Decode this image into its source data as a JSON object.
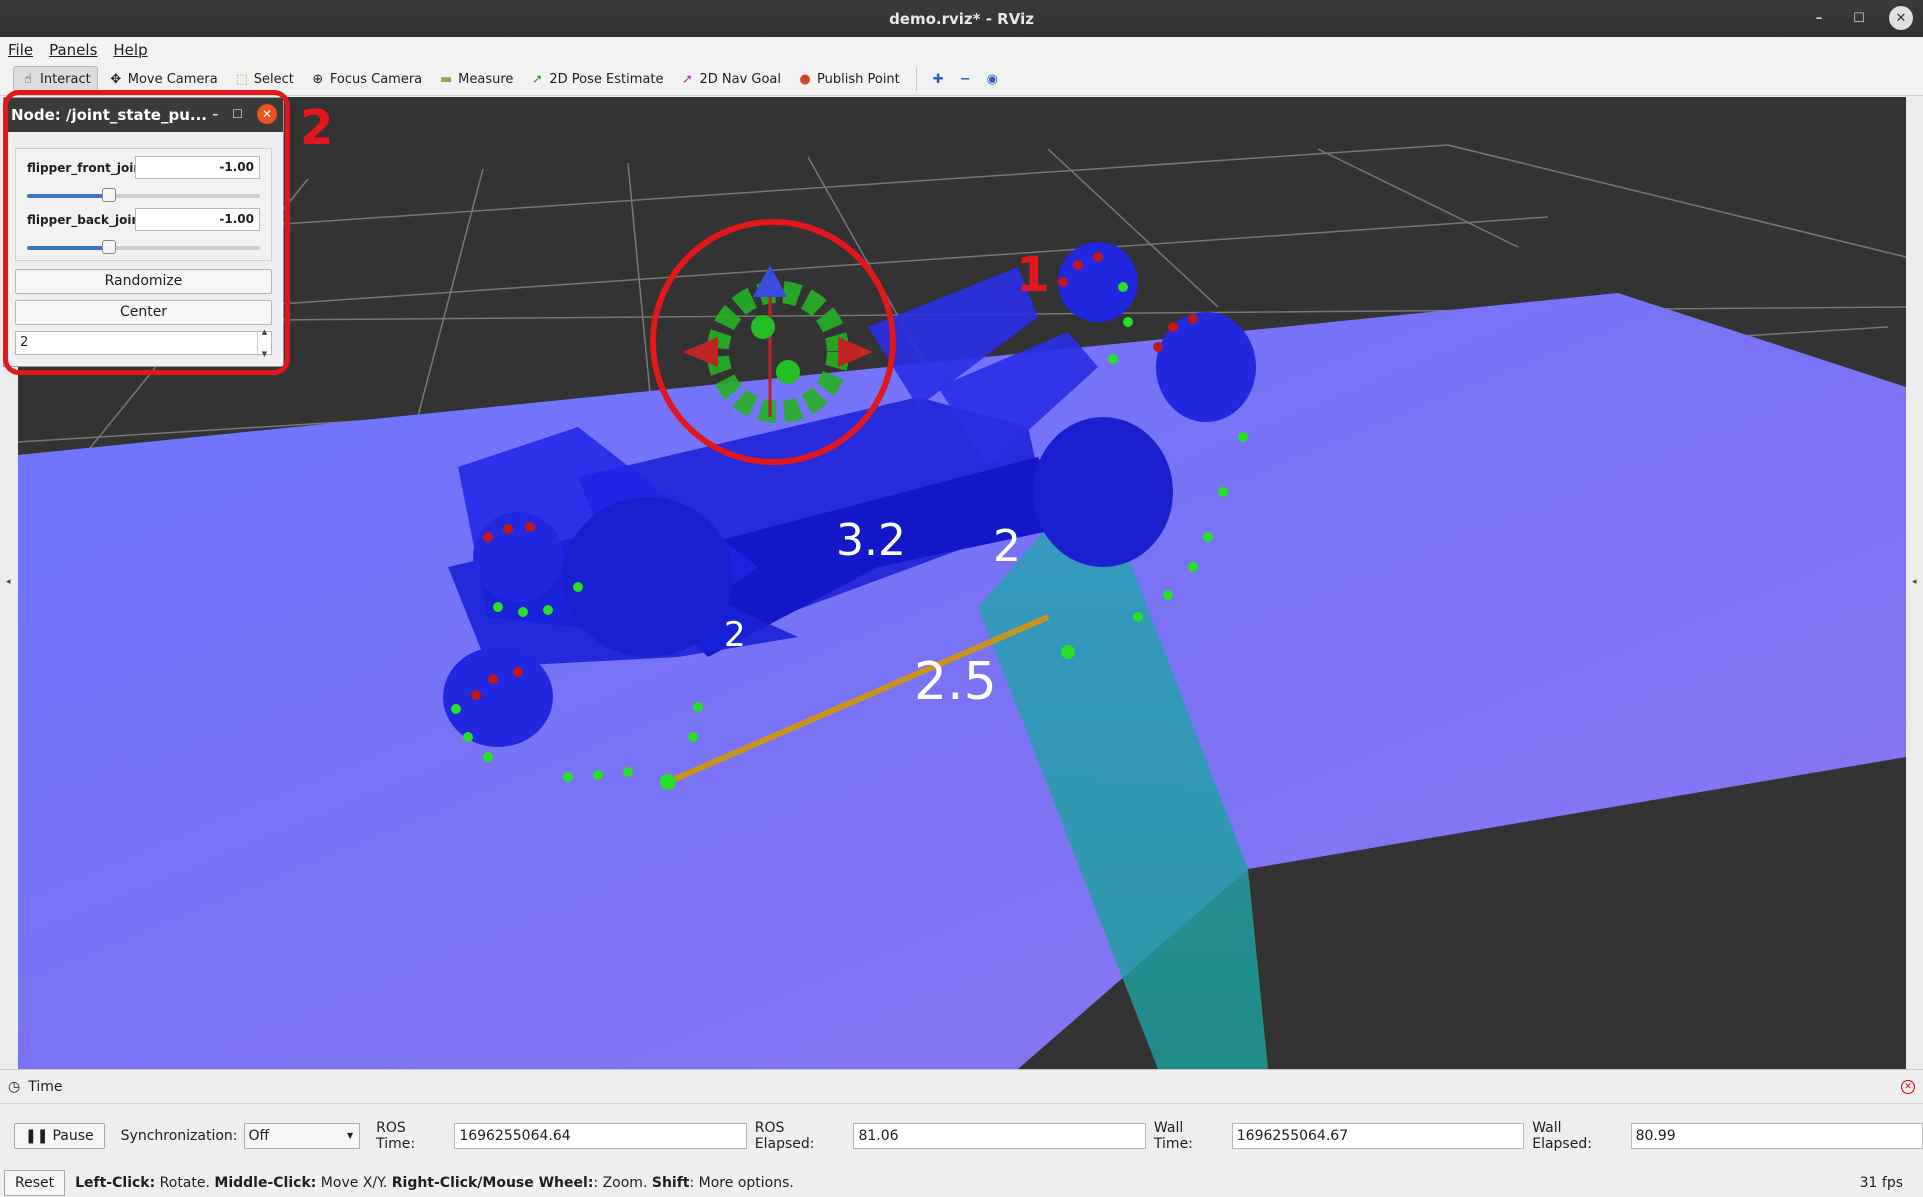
{
  "window": {
    "title": "demo.rviz* - RViz",
    "minimize": "–",
    "maximize": "☐",
    "close": "✕"
  },
  "menu": [
    "File",
    "Panels",
    "Help"
  ],
  "toolbar": {
    "tools": [
      {
        "label": "Interact",
        "icon": "hand-icon",
        "glyph": "☝"
      },
      {
        "label": "Move Camera",
        "icon": "move-icon",
        "glyph": "✥"
      },
      {
        "label": "Select",
        "icon": "select-icon",
        "glyph": "⬚"
      },
      {
        "label": "Focus Camera",
        "icon": "focus-icon",
        "glyph": "⊕"
      },
      {
        "label": "Measure",
        "icon": "ruler-icon",
        "glyph": "▬"
      },
      {
        "label": "2D Pose Estimate",
        "icon": "pose-arrow-icon",
        "glyph": "➚"
      },
      {
        "label": "2D Nav Goal",
        "icon": "nav-goal-icon",
        "glyph": "➚"
      },
      {
        "label": "Publish Point",
        "icon": "pin-icon",
        "glyph": "📍"
      }
    ],
    "add": "✚",
    "remove": "−",
    "eye": "◉"
  },
  "node_panel": {
    "title": "Node: /joint_state_pu...",
    "joints": [
      {
        "name": "flipper_front_joint",
        "value": "-1.00",
        "fraction": 0.3
      },
      {
        "name": "flipper_back_joint",
        "value": "-1.00",
        "fraction": 0.3
      }
    ],
    "randomize": "Randomize",
    "center": "Center",
    "spin_value": "2"
  },
  "annotations": {
    "marker_1": "1",
    "marker_2": "2"
  },
  "scene": {
    "labels": [
      "3.2",
      "2",
      "2",
      "2.5"
    ]
  },
  "time_panel": {
    "title": "Time",
    "pause": "Pause",
    "sync_label": "Synchronization:",
    "sync_value": "Off",
    "ros_time_label": "ROS Time:",
    "ros_time": "1696255064.64",
    "ros_elapsed_label": "ROS Elapsed:",
    "ros_elapsed": "81.06",
    "wall_time_label": "Wall Time:",
    "wall_time": "1696255064.67",
    "wall_elapsed_label": "Wall Elapsed:",
    "wall_elapsed": "80.99"
  },
  "status": {
    "reset": "Reset",
    "k1": "Left-Click:",
    "v1": " Rotate. ",
    "k2": "Middle-Click:",
    "v2": " Move X/Y. ",
    "k3": "Right-Click/Mouse Wheel:",
    "v3": ": Zoom. ",
    "k4": "Shift",
    "v4": ": More options.",
    "fps": "31 fps"
  }
}
